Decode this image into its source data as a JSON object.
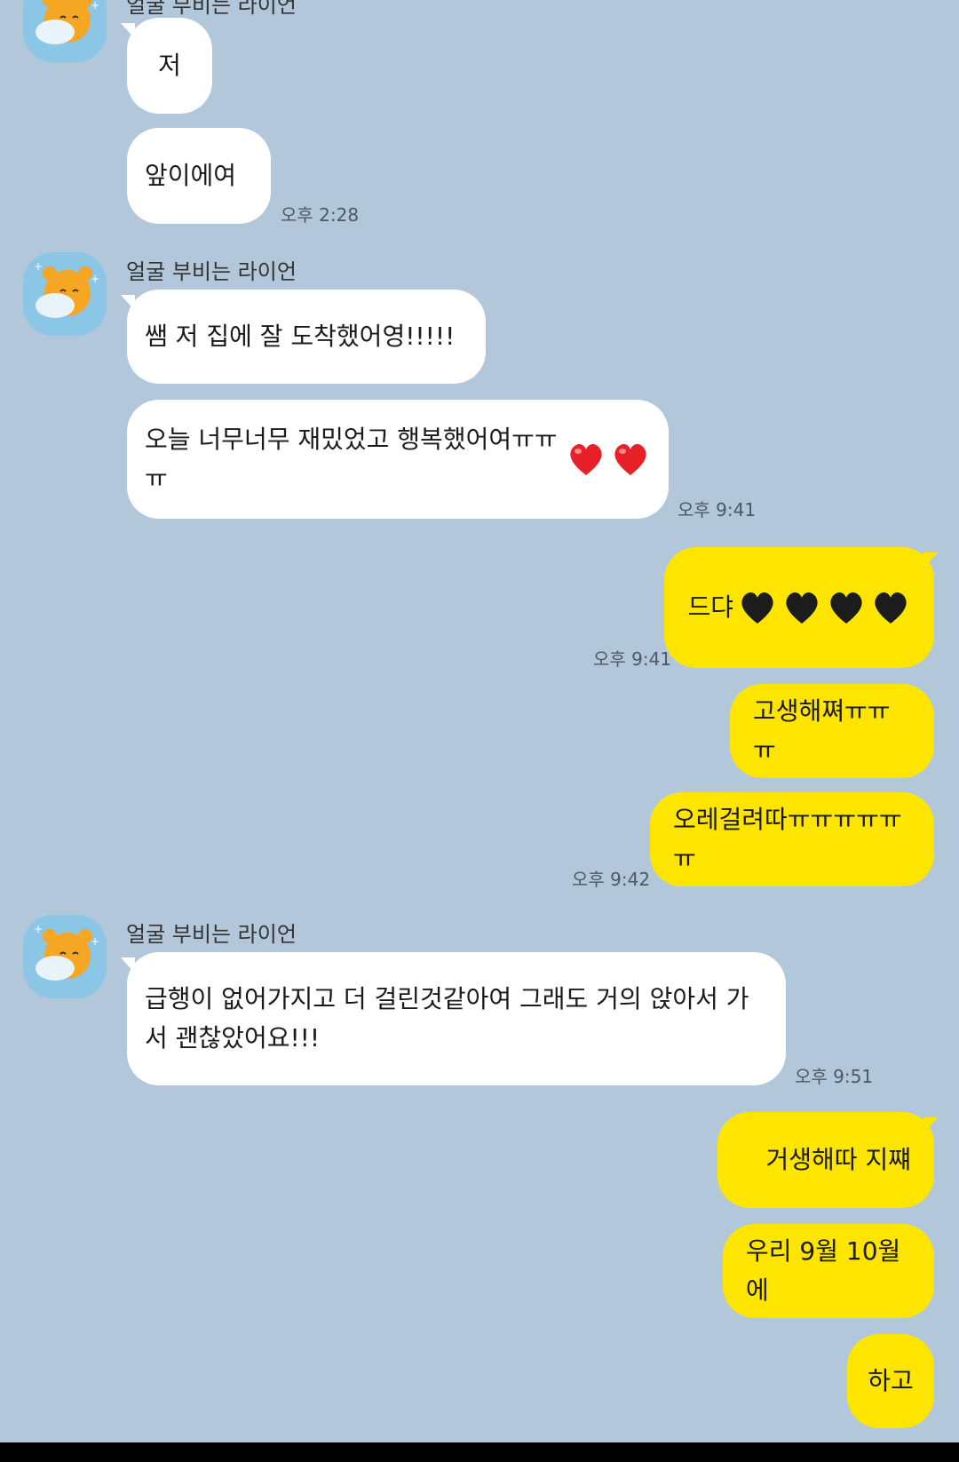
{
  "chat": {
    "sender_name": "얼굴 부비는 라이언",
    "messages": {
      "m1": "저",
      "m2": "앞이에여",
      "t1": "오후 2:28",
      "m3": "쌤 저 집에 잘 도착했어영!!!!!",
      "m4": "오늘 너무너무 재밌었고 행복했어여ㅠㅠㅠ",
      "t2": "오후 9:41",
      "m5": "드댜",
      "t3": "오후 9:41",
      "m6": "고생해쪄ㅠㅠㅠ",
      "m7": "오레걸려따ㅠㅠㅠㅠㅠㅠ",
      "t4": "오후 9:42",
      "m8_line1": "급행이 없어가지고 더 걸린것같아여 그래도 거의 앉아서 가",
      "m8_line2": "서 괜찮았어요!!!",
      "t5": "오후 9:51",
      "m9": "거생해따 지쨰",
      "m10": "우리 9월 10월에",
      "m11": "하고"
    }
  },
  "colors": {
    "background": "#b2c7d9",
    "incoming_bubble": "#ffffff",
    "outgoing_bubble": "#fee500",
    "red_heart": "#e8202a",
    "black_heart": "#1c1c1c"
  },
  "icons": {
    "avatar": "ryan-character-icon",
    "red_heart": "red-heart-emoji",
    "black_heart": "black-heart-emoji"
  }
}
